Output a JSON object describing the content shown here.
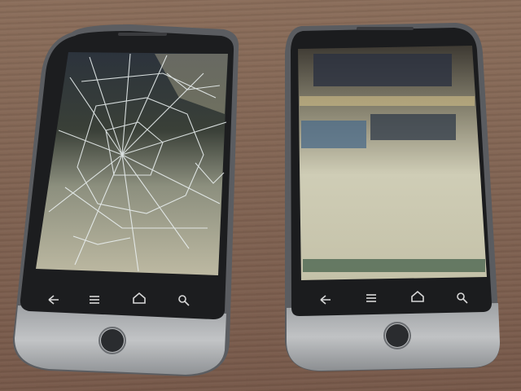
{
  "scene": {
    "subject": "two-smartphones-on-wooden-table",
    "colors": {
      "table": "#806352",
      "bezel": "#1d1e20",
      "chassis": "#a0a3a6",
      "chin": "#b4b6b8",
      "frame": "#5a5c60",
      "screen_top": "#2f3640",
      "screen_bottom": "#c7c5ad",
      "cracks": "#e6ecec"
    },
    "left_phone": {
      "state": "cracked-screen",
      "nav_icons": [
        "back-icon",
        "menu-icon",
        "home-icon",
        "search-icon"
      ]
    },
    "right_phone": {
      "state": "intact-screen",
      "nav_icons": [
        "back-icon",
        "menu-icon",
        "home-icon",
        "search-icon"
      ]
    }
  }
}
